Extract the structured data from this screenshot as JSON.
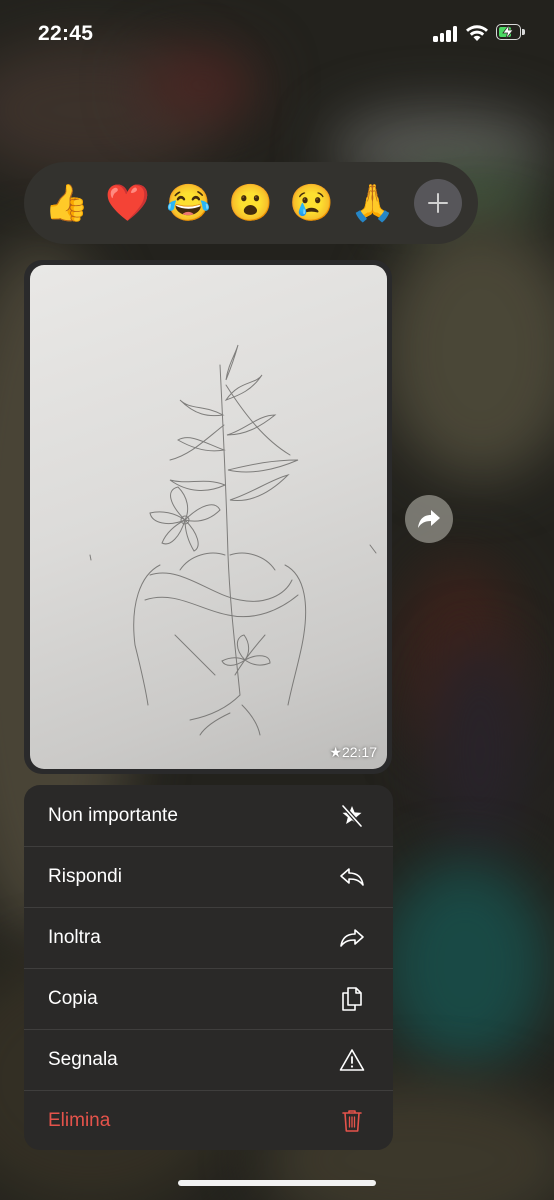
{
  "status_bar": {
    "time": "22:45",
    "icons": [
      "cellular-signal-icon",
      "wifi-icon",
      "battery-charging-icon"
    ]
  },
  "reactions": {
    "emojis": [
      {
        "name": "thumbs-up",
        "glyph": "👍"
      },
      {
        "name": "red-heart",
        "glyph": "❤️"
      },
      {
        "name": "tears-of-joy",
        "glyph": "😂"
      },
      {
        "name": "surprised",
        "glyph": "😮"
      },
      {
        "name": "crying",
        "glyph": "😢"
      },
      {
        "name": "praying-hands",
        "glyph": "🙏"
      }
    ],
    "more_icon": "plus-icon"
  },
  "message": {
    "image_description_icon": "sketch-photo",
    "timestamp": "★22:17",
    "starred": true
  },
  "forward_icon": "share-arrow-icon",
  "context_menu": {
    "items": [
      {
        "label": "Non importante",
        "icon": "unstar-icon",
        "destructive": false
      },
      {
        "label": "Rispondi",
        "icon": "reply-icon",
        "destructive": false
      },
      {
        "label": "Inoltra",
        "icon": "forward-icon",
        "destructive": false
      },
      {
        "label": "Copia",
        "icon": "copy-icon",
        "destructive": false
      },
      {
        "label": "Segnala",
        "icon": "warning-icon",
        "destructive": false
      },
      {
        "label": "Elimina",
        "icon": "trash-icon",
        "destructive": true
      }
    ]
  },
  "colors": {
    "menu_background": "#2a2928",
    "reaction_bar": "#33322e",
    "destructive": "#e5534b",
    "battery_fill": "#4cd964"
  }
}
